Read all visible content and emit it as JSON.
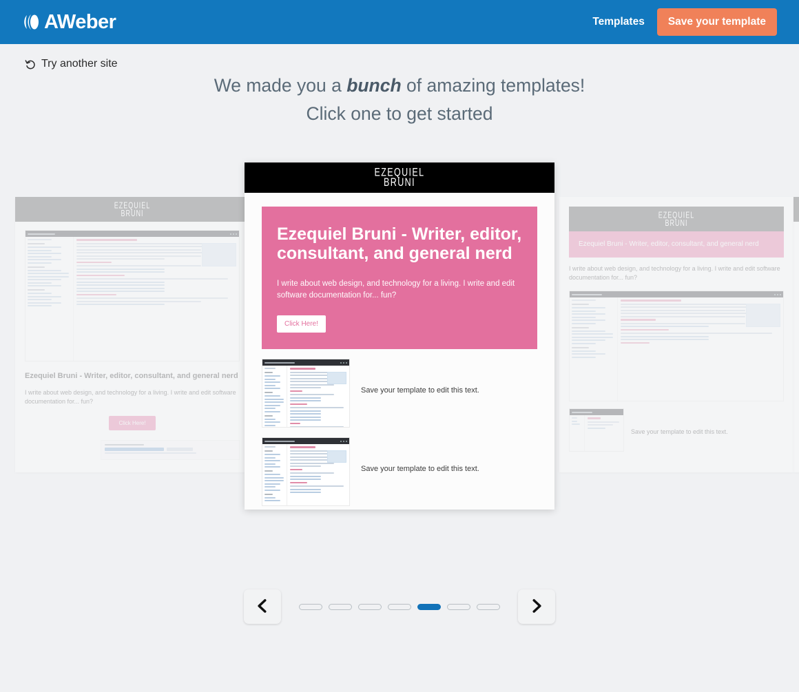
{
  "header": {
    "brand": "AWeber",
    "brand_icon": "aweber-swoosh-icon",
    "nav_link": "Templates",
    "save_button": "Save your template",
    "bg_color": "#1278be",
    "save_button_color": "#f08159"
  },
  "toolbar": {
    "try_another_site": "Try another site",
    "undo_icon": "undo-arrow-icon"
  },
  "headline": {
    "line1_before": "We made you a ",
    "line1_emphasis": "bunch",
    "line1_after": " of amazing templates!",
    "line2": "Click one to get started"
  },
  "center_template": {
    "brand_line1": "EZEQUIEL",
    "brand_line2": "BRUNI",
    "hero_heading": "Ezequiel Bruni - Writer, editor, consultant, and general nerd",
    "hero_body": "I write about web design, and technology for a living. I write and edit software documentation for... fun?",
    "cta_label": "Click Here!",
    "hero_bg_color": "#e3709e",
    "header_bg_color": "#000000",
    "blocks": [
      {
        "text": "Save your template to edit this text."
      },
      {
        "text": "Save your template to edit this text."
      }
    ]
  },
  "left_template": {
    "brand_line1": "EZEQUIEL",
    "brand_line2": "BRUNI",
    "heading": "Ezequiel Bruni - Writer, editor, consultant, and general nerd",
    "body": "I write about web design, and technology for a living. I write and edit software documentation for... fun?",
    "cta_label": "Click Here!"
  },
  "right_template": {
    "brand_line1": "EZEQUIEL",
    "brand_line2": "BRUNI",
    "heading": "Ezequiel Bruni - Writer, editor, consultant, and general nerd",
    "body": "I write about web design, and technology for a living. I write and edit software documentation for... fun?",
    "save_text": "Save your template to edit this text."
  },
  "pagination": {
    "prev_icon": "chevron-left-icon",
    "next_icon": "chevron-right-icon",
    "total": 7,
    "active_index": 5,
    "active_color": "#1272b8"
  }
}
